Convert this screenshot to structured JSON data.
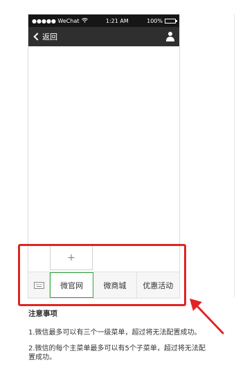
{
  "status_bar": {
    "carrier": "●●●●● WeChat",
    "wifi_icon": "wifi-icon",
    "time": "1:21 AM",
    "battery_percent": "100%",
    "battery_level": 1.0
  },
  "nav": {
    "back_label": "返回",
    "user_icon": "user-icon"
  },
  "menu": {
    "add_label": "+",
    "keyboard_icon": "keyboard-icon",
    "items": [
      {
        "label": "微官网",
        "active": true
      },
      {
        "label": "微商城",
        "active": false
      },
      {
        "label": "优惠活动",
        "active": false
      }
    ]
  },
  "notes": {
    "title": "注意事项",
    "items": [
      "1.微信最多可以有三个一级菜单，超过将无法配置成功。",
      "2.微信的每个主菜单最多可以有5个子菜单，超过将无法配置成功。"
    ]
  },
  "colors": {
    "highlight": "#e02424",
    "active_border": "#2fa53a",
    "navbar": "#2f2f2f",
    "statusbar": "#161616"
  }
}
